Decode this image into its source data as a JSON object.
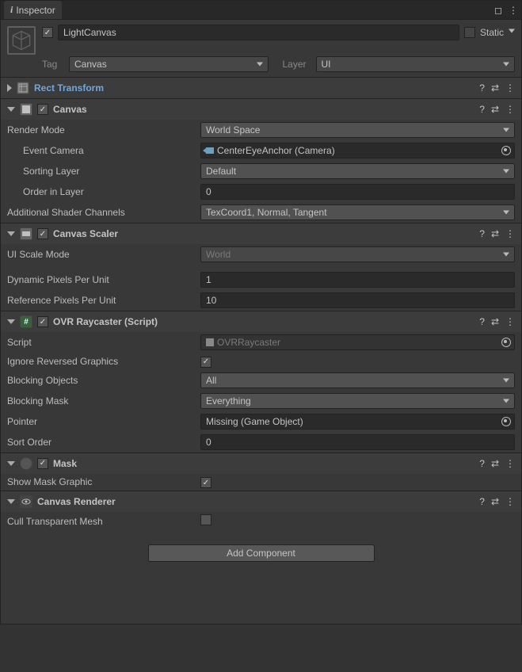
{
  "tab": {
    "title": "Inspector"
  },
  "header": {
    "name": "LightCanvas",
    "enabled": true,
    "static_label": "Static",
    "tag_label": "Tag",
    "tag_value": "Canvas",
    "layer_label": "Layer",
    "layer_value": "UI"
  },
  "rect_transform": {
    "title": "Rect Transform"
  },
  "canvas": {
    "title": "Canvas",
    "render_mode": {
      "label": "Render Mode",
      "value": "World Space"
    },
    "event_camera": {
      "label": "Event Camera",
      "value": "CenterEyeAnchor (Camera)"
    },
    "sorting_layer": {
      "label": "Sorting Layer",
      "value": "Default"
    },
    "order_in_layer": {
      "label": "Order in Layer",
      "value": "0"
    },
    "additional_channels": {
      "label": "Additional Shader Channels",
      "value": "TexCoord1, Normal, Tangent"
    }
  },
  "canvas_scaler": {
    "title": "Canvas Scaler",
    "ui_scale_mode": {
      "label": "UI Scale Mode",
      "value": "World"
    },
    "dynamic_ppu": {
      "label": "Dynamic Pixels Per Unit",
      "value": "1"
    },
    "reference_ppu": {
      "label": "Reference Pixels Per Unit",
      "value": "10"
    }
  },
  "ovr_raycaster": {
    "title": "OVR Raycaster (Script)",
    "script": {
      "label": "Script",
      "value": "OVRRaycaster"
    },
    "ignore_reversed": {
      "label": "Ignore Reversed Graphics"
    },
    "blocking_objects": {
      "label": "Blocking Objects",
      "value": "All"
    },
    "blocking_mask": {
      "label": "Blocking Mask",
      "value": "Everything"
    },
    "pointer": {
      "label": "Pointer",
      "value": "Missing (Game Object)"
    },
    "sort_order": {
      "label": "Sort Order",
      "value": "0"
    }
  },
  "mask": {
    "title": "Mask",
    "show_graphic": {
      "label": "Show Mask Graphic"
    }
  },
  "canvas_renderer": {
    "title": "Canvas Renderer",
    "cull": {
      "label": "Cull Transparent Mesh"
    }
  },
  "add_component": "Add Component"
}
